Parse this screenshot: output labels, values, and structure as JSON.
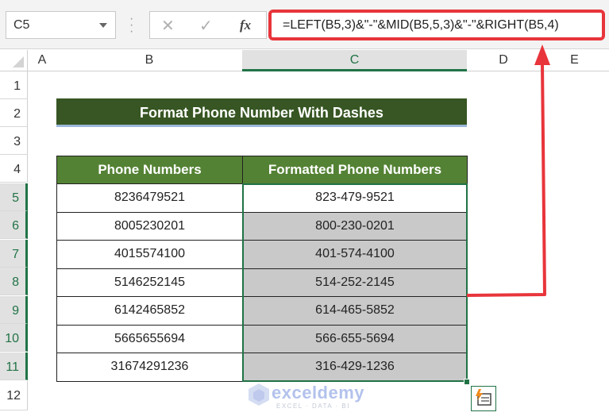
{
  "formula_bar": {
    "name_box": "C5",
    "cancel_icon": "✕",
    "enter_icon": "✓",
    "fx_label": "fx",
    "formula": "=LEFT(B5,3)&\"-\"&MID(B5,5,3)&\"-\"&RIGHT(B5,4)"
  },
  "columns": [
    "A",
    "B",
    "C",
    "D",
    "E"
  ],
  "selected_column": "C",
  "rows": [
    "1",
    "2",
    "3",
    "4",
    "5",
    "6",
    "7",
    "8",
    "9",
    "10",
    "11",
    "12"
  ],
  "title": "Format Phone Number With Dashes",
  "table": {
    "headers": [
      "Phone Numbers",
      "Formatted Phone Numbers"
    ],
    "rows": [
      [
        "8236479521",
        "823-479-9521"
      ],
      [
        "8005230201",
        "800-230-0201"
      ],
      [
        "4015574100",
        "401-574-4100"
      ],
      [
        "5146252145",
        "514-252-2145"
      ],
      [
        "6142465852",
        "614-465-5852"
      ],
      [
        "5665655694",
        "566-655-5694"
      ],
      [
        "31674291236",
        "316-429-1236"
      ]
    ]
  },
  "watermark": {
    "name": "exceldemy",
    "tagline": "EXCEL · DATA · BI"
  },
  "colors": {
    "title_bg": "#375623",
    "header_bg": "#548235",
    "selection": "#217346",
    "highlight": "#e8353b",
    "filled_cell": "#c9c9c9"
  }
}
